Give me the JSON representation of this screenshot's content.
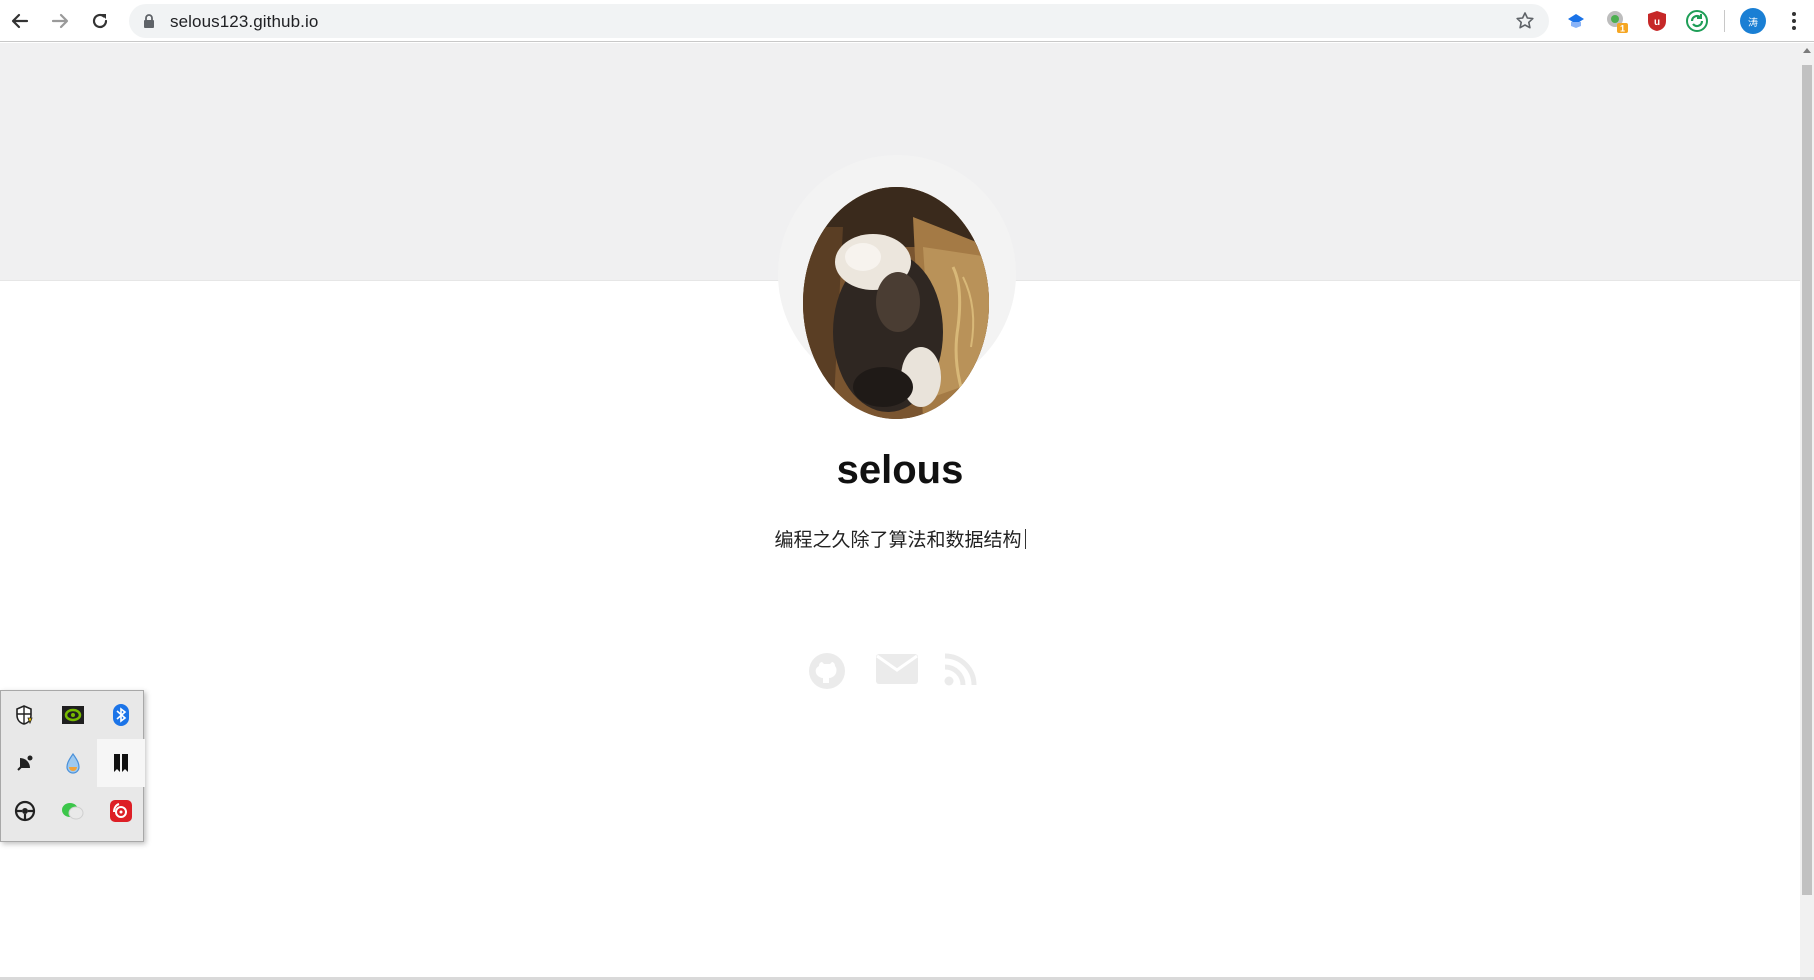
{
  "browser": {
    "url": "selous123.github.io",
    "profile_initial": "涛",
    "icons": {
      "back": "back-arrow-icon",
      "forward": "forward-arrow-icon",
      "reload": "reload-icon",
      "lock": "lock-icon",
      "bookmark": "star-icon",
      "menu": "kebab-menu-icon"
    },
    "extensions": [
      {
        "name": "translate-extension-icon",
        "color": "#1a73e8"
      },
      {
        "name": "chrome-extension-icon",
        "badge": "1",
        "color": "#4caf50"
      },
      {
        "name": "ublock-icon",
        "color": "#c62828"
      },
      {
        "name": "sync-extension-icon",
        "color": "#1e9e57"
      }
    ],
    "profile_color": "#1a7fd4"
  },
  "profile": {
    "name": "selous",
    "tagline": "编程之久除了算法和数据结构",
    "socials": [
      {
        "name": "github-icon"
      },
      {
        "name": "email-icon"
      },
      {
        "name": "rss-icon"
      }
    ],
    "social_color": "#ebebeb",
    "band_color": "#f0f0f1"
  },
  "tray": {
    "items": [
      {
        "name": "security-shield-icon"
      },
      {
        "name": "nvidia-icon"
      },
      {
        "name": "bluetooth-icon"
      },
      {
        "name": "satellite-icon"
      },
      {
        "name": "droplet-icon"
      },
      {
        "name": "bookmark-app-icon"
      },
      {
        "name": "steering-wheel-icon"
      },
      {
        "name": "wechat-icon"
      },
      {
        "name": "netease-music-icon"
      }
    ]
  }
}
